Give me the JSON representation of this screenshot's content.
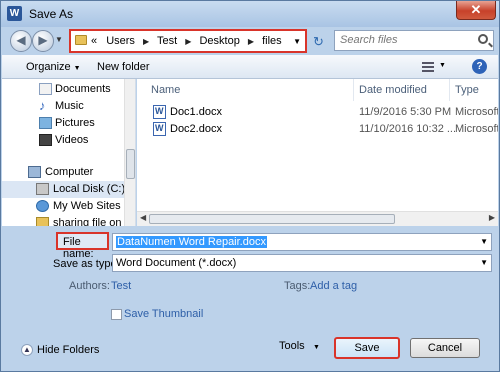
{
  "window": {
    "title": "Save As",
    "app_icon": "W",
    "close_label": "✕"
  },
  "nav": {
    "breadcrumb": [
      "Users",
      "Test",
      "Desktop",
      "files"
    ],
    "crumb_prefix": "«",
    "search_placeholder": "Search files"
  },
  "toolbar": {
    "organize_label": "Organize",
    "new_folder_label": "New folder",
    "help_label": "?"
  },
  "sidebar": {
    "items": [
      {
        "label": "Documents",
        "icon": "documents-icon"
      },
      {
        "label": "Music",
        "icon": "music-icon"
      },
      {
        "label": "Pictures",
        "icon": "pictures-icon"
      },
      {
        "label": "Videos",
        "icon": "videos-icon"
      },
      {
        "label": "Computer",
        "icon": "computer-icon"
      },
      {
        "label": "Local Disk (C:)",
        "icon": "local-disk-icon"
      },
      {
        "label": "My Web Sites on",
        "icon": "web-sites-icon"
      },
      {
        "label": "sharing file on d",
        "icon": "shared-folder-icon"
      }
    ]
  },
  "filelist": {
    "columns": [
      "Name",
      "Date modified",
      "Type"
    ],
    "rows": [
      {
        "name": "Doc1.docx",
        "date": "11/9/2016 5:30 PM",
        "type": "Microsoft"
      },
      {
        "name": "Doc2.docx",
        "date": "11/10/2016 10:32 ...",
        "type": "Microsoft"
      }
    ]
  },
  "form": {
    "file_name_label": "File name:",
    "file_name_value": "DataNumen Word Repair.docx",
    "save_type_label": "Save as type:",
    "save_type_value": "Word Document (*.docx)",
    "authors_label": "Authors:",
    "authors_value": "Test",
    "tags_label": "Tags:",
    "tags_value": "Add a tag",
    "save_thumbnail_label": "Save Thumbnail"
  },
  "footer": {
    "hide_folders_label": "Hide Folders",
    "tools_label": "Tools",
    "save_label": "Save",
    "cancel_label": "Cancel"
  },
  "colors": {
    "highlight_border": "#d9342a",
    "selection": "#3399ff",
    "link": "#2e5fa8"
  }
}
